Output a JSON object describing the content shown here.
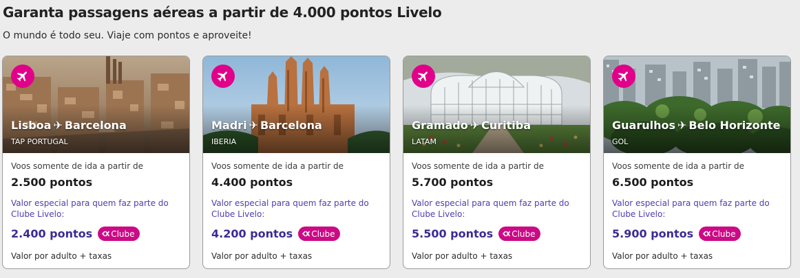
{
  "header": {
    "title": "Garanta passagens aéreas a partir de 4.000 pontos Livelo",
    "subtitle": "O mundo é todo seu. Viaje com pontos e aproveite!"
  },
  "colors": {
    "brand_pink": "#e0008a",
    "club_purple": "#3b2b94",
    "club_badge": "#cc0a85"
  },
  "cards": [
    {
      "icon": "airplane-icon",
      "origin": "Lisboa",
      "destination": "Barcelona",
      "airline": "TAP PORTUGAL",
      "one_way_label": "Voos somente de ida a partir de",
      "points": "2.500 pontos",
      "club_text": "Valor especial para quem faz parte do Clube Livelo:",
      "club_points": "2.400 pontos",
      "club_badge": "Clube",
      "footer": "Valor por adulto + taxas"
    },
    {
      "icon": "airplane-icon",
      "origin": "Madri",
      "destination": "Barcelona",
      "airline": "IBERIA",
      "one_way_label": "Voos somente de ida a partir de",
      "points": "4.400 pontos",
      "club_text": "Valor especial para quem faz parte do Clube Livelo:",
      "club_points": "4.200 pontos",
      "club_badge": "Clube",
      "footer": "Valor por adulto + taxas"
    },
    {
      "icon": "airplane-icon",
      "origin": "Gramado",
      "destination": "Curitiba",
      "airline": "LATAM",
      "one_way_label": "Voos somente de ida a partir de",
      "points": "5.700 pontos",
      "club_text": "Valor especial para quem faz parte do Clube Livelo:",
      "club_points": "5.500 pontos",
      "club_badge": "Clube",
      "footer": "Valor por adulto + taxas"
    },
    {
      "icon": "airplane-icon",
      "origin": "Guarulhos",
      "destination": "Belo Horizonte",
      "airline": "GOL",
      "one_way_label": "Voos somente de ida a partir de",
      "points": "6.500 pontos",
      "club_text": "Valor especial para quem faz parte do Clube Livelo:",
      "club_points": "5.900 pontos",
      "club_badge": "Clube",
      "footer": "Valor por adulto + taxas"
    }
  ]
}
